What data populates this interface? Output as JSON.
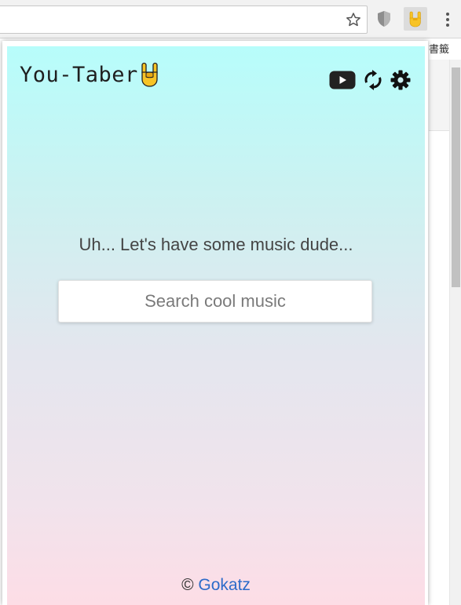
{
  "browser": {
    "bookmark_label": "書籤",
    "icons": [
      "star-icon",
      "shield-icon",
      "rock-hand-icon",
      "kebab-menu-icon"
    ]
  },
  "app": {
    "title": "You-Taber",
    "title_emoji": "rock-hand-icon",
    "header_icons": [
      "youtube-icon",
      "refresh-icon",
      "gear-icon"
    ]
  },
  "main": {
    "empty_message": "Uh... Let's have some music dude...",
    "search": {
      "placeholder": "Search cool music",
      "value": ""
    }
  },
  "footer": {
    "copyright_symbol": "©",
    "author_link": "Gokatz"
  },
  "colors": {
    "gradient_top": "#b7fdfb",
    "gradient_bottom": "#fddde6",
    "link": "#2c6bc9",
    "emoji_yellow": "#f7c325"
  }
}
